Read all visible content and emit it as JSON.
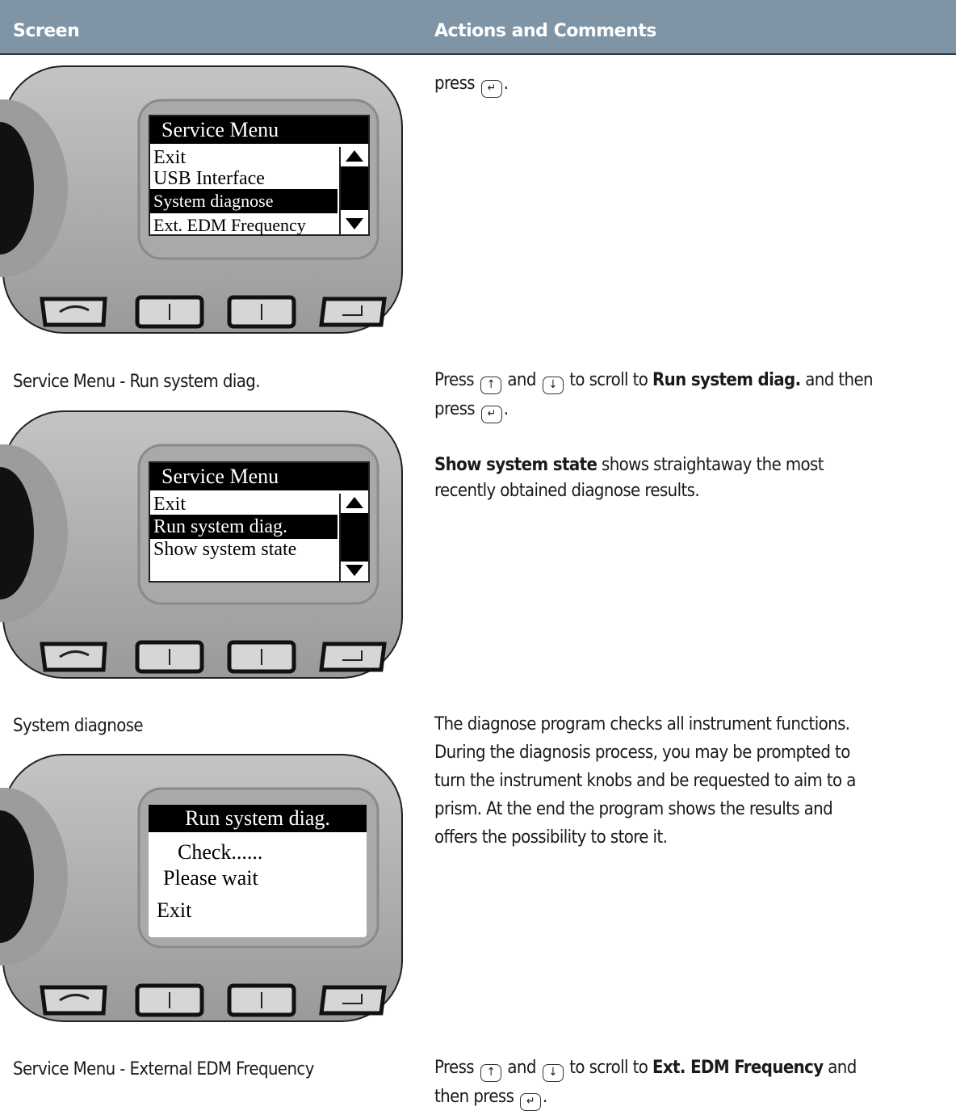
{
  "header": {
    "col1": "Screen",
    "col2": "Actions and Comments"
  },
  "row1": {
    "text_a": "press",
    "text_b": "."
  },
  "screen1": {
    "title": "Service Menu",
    "items": [
      "Exit",
      "USB Interface",
      "System diagnose",
      "Ext. EDM Frequency"
    ],
    "selected": 2
  },
  "row2": {
    "caption": "Service Menu - Run system diag.",
    "p1a": "Press",
    "p1b": "and",
    "p1c": "to scroll to",
    "p1bold": "Run system diag.",
    "p1d": "and then",
    "p1e": "press",
    "p1f": ".",
    "p2bold": "Show system state",
    "p2a": "shows straightaway the most",
    "p2b": "recently obtained diagnose results."
  },
  "screen2": {
    "title": "Service Menu",
    "items": [
      "Exit",
      "Run system diag.",
      "Show system state"
    ],
    "selected": 1
  },
  "row3": {
    "caption": "System diagnose",
    "lines": [
      "The diagnose program checks all instrument functions.",
      "During the diagnosis process, you may be prompted to",
      "turn the instrument knobs and be requested to aim to a",
      "prism. At the end the program shows the results and",
      "offers the possibility to store it."
    ]
  },
  "screen3": {
    "title": "Run system diag.",
    "line1": "Check......",
    "line2": "Please wait",
    "line3": "Exit"
  },
  "row4": {
    "caption": "Service Menu - External EDM Frequency",
    "a": "Press",
    "b": "and",
    "c": "to scroll to",
    "bold": "Ext. EDM Frequency",
    "d": "and",
    "e": "then press",
    "f": "."
  },
  "keys": {
    "up": "↑",
    "down": "↓",
    "enter": "↵"
  },
  "icons": [
    "undo-key-icon",
    "up-key-icon",
    "down-key-icon",
    "enter-key-icon"
  ]
}
